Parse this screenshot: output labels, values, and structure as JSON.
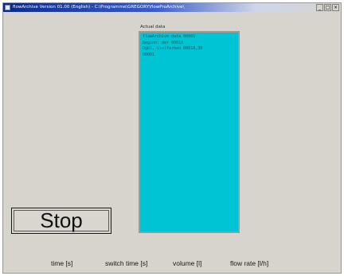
{
  "window": {
    "title": "flowArchive Version 01.00 (English) - C:\\Programme\\GREGORY\\flowProArchive\\",
    "minimize_glyph": "_",
    "maximize_glyph": "□",
    "close_glyph": "×"
  },
  "actual_data": {
    "label": "Actual data",
    "lines": [
      "flowArchive data 00001",
      "Beginn: der 00010",
      "Dgbl, Vielfarben 00018,30",
      "00001"
    ]
  },
  "stop_button": {
    "label": "Stop"
  },
  "columns": [
    {
      "label": "time [s]"
    },
    {
      "label": "switch time [s]"
    },
    {
      "label": "volume [l]"
    },
    {
      "label": "flow rate [l/h]"
    }
  ]
}
